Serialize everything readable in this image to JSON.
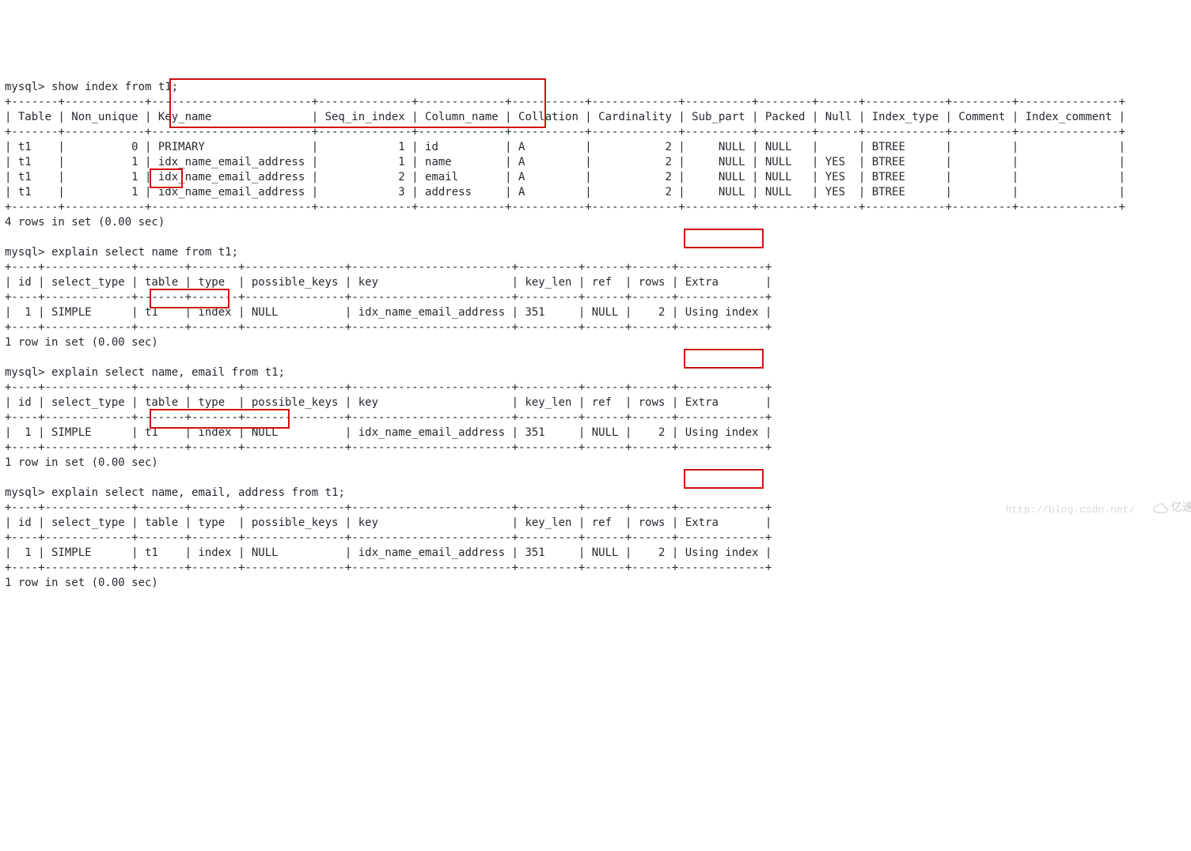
{
  "prompt": "mysql>",
  "cmd1": "show index from t1;",
  "sep_full": "+-------+------------+------------------------+--------------+-------------+-----------+-------------+----------+--------+------+------------+---------+---------------+",
  "index_header": "| Table | Non_unique | Key_name               | Seq_in_index | Column_name | Collation | Cardinality | Sub_part | Packed | Null | Index_type | Comment | Index_comment |",
  "idx_rows": [
    "| t1    |          0 | PRIMARY                |            1 | id          | A         |           2 |     NULL | NULL   |      | BTREE      |         |               |",
    "| t1    |          1 | idx_name_email_address |            1 | name        | A         |           2 |     NULL | NULL   | YES  | BTREE      |         |               |",
    "| t1    |          1 | idx_name_email_address |            2 | email       | A         |           2 |     NULL | NULL   | YES  | BTREE      |         |               |",
    "| t1    |          1 | idx_name_email_address |            3 | address     | A         |           2 |     NULL | NULL   | YES  | BTREE      |         |               |"
  ],
  "rows4": "4 rows in set (0.00 sec)",
  "rows1": "1 row in set (0.00 sec)",
  "cmd2": "explain select name from t1;",
  "cmd3": "explain select name, email from t1;",
  "cmd4": "explain select name, email, address from t1;",
  "exp_sep": "+----+-------------+-------+-------+---------------+------------------------+---------+------+------+-------------+",
  "exp_header": "| id | select_type | table | type  | possible_keys | key                    | key_len | ref  | rows | Extra       |",
  "exp_row": "|  1 | SIMPLE      | t1    | index | NULL          | idx_name_email_address | 351     | NULL |    2 | Using index |",
  "watermark_url": "http://blog.csdn.net/",
  "watermark_brand": "亿速云"
}
